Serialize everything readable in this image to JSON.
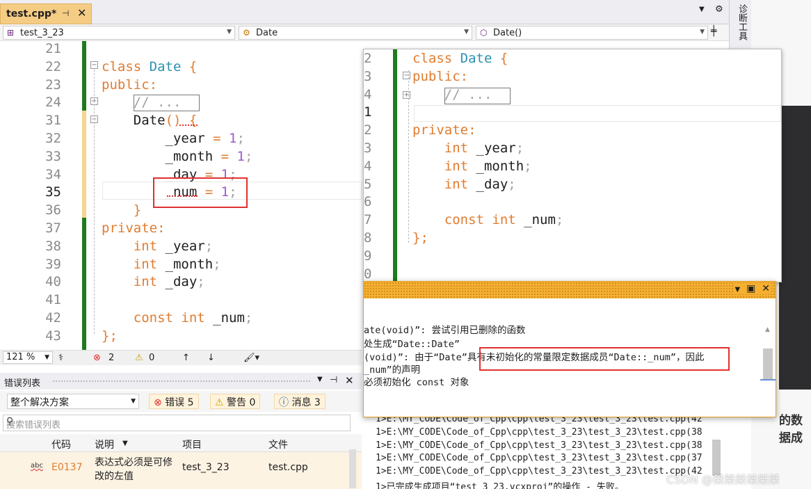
{
  "editor": {
    "tab_title": "test.cpp*",
    "nav": {
      "project": "test_3_23",
      "scope": "Date",
      "member": "Date()"
    },
    "side_tab": "诊断工具",
    "lines": [
      {
        "n": "21",
        "code": []
      },
      {
        "n": "22",
        "code": [
          [
            "kw",
            "class "
          ],
          [
            "ty",
            "Date"
          ],
          [
            "kw",
            " {"
          ]
        ]
      },
      {
        "n": "23",
        "code": [
          [
            "kw",
            "public:"
          ]
        ]
      },
      {
        "n": "24",
        "code": [
          [
            "pn",
            "    // ..."
          ]
        ]
      },
      {
        "n": "31",
        "code": [
          [
            "pl",
            "    Date"
          ],
          [
            "kw",
            "() {"
          ]
        ]
      },
      {
        "n": "32",
        "code": [
          [
            "pl",
            "        _year"
          ],
          [
            "kw",
            " = "
          ],
          [
            "num",
            "1"
          ],
          [
            "pn",
            ";"
          ]
        ]
      },
      {
        "n": "33",
        "code": [
          [
            "pl",
            "        _month"
          ],
          [
            "kw",
            " = "
          ],
          [
            "num",
            "1"
          ],
          [
            "pn",
            ";"
          ]
        ]
      },
      {
        "n": "34",
        "code": [
          [
            "pl",
            "        _day"
          ],
          [
            "kw",
            " = "
          ],
          [
            "num",
            "1"
          ],
          [
            "pn",
            ";"
          ]
        ]
      },
      {
        "n": "35",
        "code": [
          [
            "pl",
            "        _num"
          ],
          [
            "kw",
            " = "
          ],
          [
            "num",
            "1"
          ],
          [
            "pn",
            ";"
          ]
        ]
      },
      {
        "n": "36",
        "code": [
          [
            "kw",
            "    }"
          ]
        ]
      },
      {
        "n": "37",
        "code": [
          [
            "kw",
            "private:"
          ]
        ]
      },
      {
        "n": "38",
        "code": [
          [
            "kw",
            "    int "
          ],
          [
            "pl",
            "_year"
          ],
          [
            "pn",
            ";"
          ]
        ]
      },
      {
        "n": "39",
        "code": [
          [
            "kw",
            "    int "
          ],
          [
            "pl",
            "_month"
          ],
          [
            "pn",
            ";"
          ]
        ]
      },
      {
        "n": "40",
        "code": [
          [
            "kw",
            "    int "
          ],
          [
            "pl",
            "_day"
          ],
          [
            "pn",
            ";"
          ]
        ]
      },
      {
        "n": "41",
        "code": []
      },
      {
        "n": "42",
        "code": [
          [
            "kw",
            "    const int "
          ],
          [
            "pl",
            "_num"
          ],
          [
            "pn",
            ";"
          ]
        ]
      },
      {
        "n": "43",
        "code": [
          [
            "kw",
            "};"
          ]
        ]
      }
    ],
    "status": {
      "zoom": "121 %",
      "errors": "2",
      "warnings": "0"
    }
  },
  "popup": {
    "lines": [
      {
        "n": "2",
        "code": [
          [
            "kw",
            "class "
          ],
          [
            "ty",
            "Date"
          ],
          [
            "kw",
            " {"
          ]
        ]
      },
      {
        "n": "3",
        "code": [
          [
            "kw",
            "public:"
          ]
        ]
      },
      {
        "n": "4",
        "code": [
          [
            "pn",
            "    // ..."
          ]
        ]
      },
      {
        "n": "1",
        "code": []
      },
      {
        "n": "2",
        "code": [
          [
            "kw",
            "private:"
          ]
        ]
      },
      {
        "n": "3",
        "code": [
          [
            "kw",
            "    int "
          ],
          [
            "pl",
            "_year"
          ],
          [
            "pn",
            ";"
          ]
        ]
      },
      {
        "n": "4",
        "code": [
          [
            "kw",
            "    int "
          ],
          [
            "pl",
            "_month"
          ],
          [
            "pn",
            ";"
          ]
        ]
      },
      {
        "n": "5",
        "code": [
          [
            "kw",
            "    int "
          ],
          [
            "pl",
            "_day"
          ],
          [
            "pn",
            ";"
          ]
        ]
      },
      {
        "n": "6",
        "code": []
      },
      {
        "n": "7",
        "code": [
          [
            "kw",
            "    const int "
          ],
          [
            "pl",
            "_num"
          ],
          [
            "pn",
            ";"
          ]
        ]
      },
      {
        "n": "8",
        "code": [
          [
            "kw",
            "};"
          ]
        ]
      },
      {
        "n": "9",
        "code": []
      },
      {
        "n": "0",
        "code": []
      }
    ]
  },
  "output": {
    "lines": [
      "ate(void)”: 尝试引用已删除的函数",
      "处生成“Date::Date”",
      "(void)”: 由于“Date”具有未初始化的常量限定数据成员“Date::_num”，因此",
      "_num”的声明",
      "必须初始化 const 对象"
    ]
  },
  "build_log": [
    "1>E:\\MY_CODE\\Code_of_Cpp\\cpp\\test_3_23\\test_3_23\\test.cpp(42",
    "1>E:\\MY_CODE\\Code_of_Cpp\\cpp\\test_3_23\\test_3_23\\test.cpp(38",
    "1>E:\\MY_CODE\\Code_of_Cpp\\cpp\\test_3_23\\test_3_23\\test.cpp(38",
    "1>E:\\MY_CODE\\Code_of_Cpp\\cpp\\test_3_23\\test_3_23\\test.cpp(37",
    "1>E:\\MY_CODE\\Code_of_Cpp\\cpp\\test_3_23\\test_3_23\\test.cpp(42",
    "1>已完成生成项目“test_3_23.vcxproj”的操作 - 失败。"
  ],
  "error_list": {
    "title": "错误列表",
    "scope": "整个解决方案",
    "errors_chip": "错误 5",
    "warnings_chip": "警告 0",
    "messages_chip": "消息 3",
    "search_placeholder": "搜索错误列表",
    "columns": {
      "code": "代码",
      "desc": "说明",
      "project": "项目",
      "file": "文件"
    },
    "row": {
      "code": "E0137",
      "desc_1": "表达式必须是可修",
      "desc_2": "改的左值",
      "project": "test_3_23",
      "file": "test.cpp"
    }
  },
  "right_fragment": "的数据成",
  "watermark": "CSDN @桀桀桀桀桀桀",
  "colors": {
    "keyword": "#e07c30",
    "type": "#2b91af",
    "number": "#9b59d0",
    "tab": "#f5cc84",
    "output_title": "#f5b031",
    "error_box": "#e03030"
  }
}
